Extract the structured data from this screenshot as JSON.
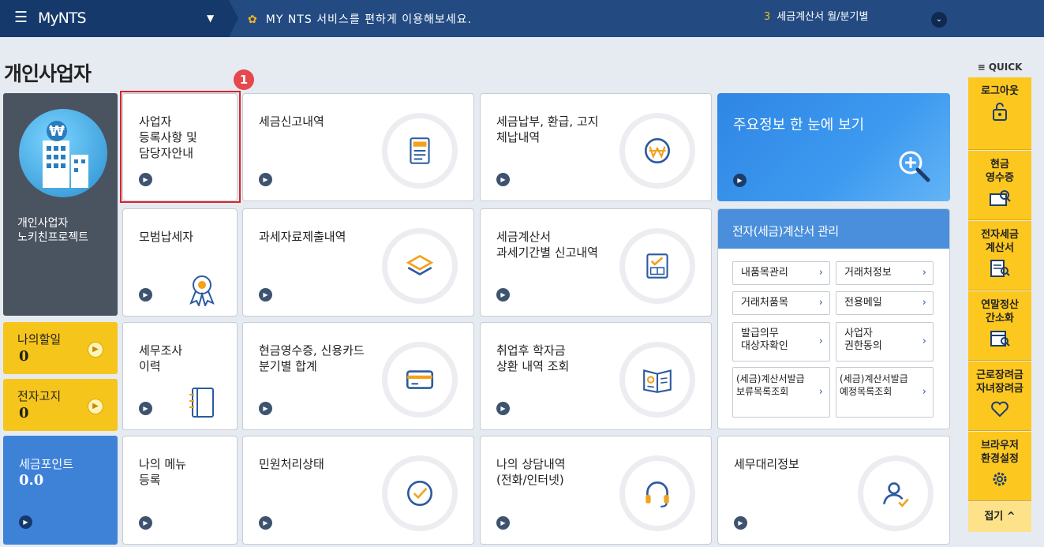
{
  "header": {
    "menu_icon": "☰",
    "app_title": "MyNTS",
    "caret": "▼",
    "notice_icon": "✿",
    "notice": "MY NTS 서비스를 편하게 이용해보세요.",
    "ticker_num": "3",
    "ticker_text": "세금계산서 월/분기별",
    "ticker_btn": "⌄"
  },
  "page_title": "개인사업자",
  "badge": "1",
  "profile": {
    "line1": "개인사업자",
    "line2": "노키친프로젝트"
  },
  "todo": {
    "label": "나의할일",
    "value": "0"
  },
  "notice_card": {
    "label": "전자고지",
    "value": "0"
  },
  "points": {
    "label": "세금포인트",
    "value": "0.0"
  },
  "tiles": {
    "t1": "사업자\n등록사항 및\n담당자안내",
    "t2": "세금신고내역",
    "t3": "세금납부, 환급, 고지\n체납내역",
    "t4": "모범납세자",
    "t5": "과세자료제출내역",
    "t6": "세금계산서\n과세기간별 신고내역",
    "t7": "세무조사\n이력",
    "t8": "현금영수증, 신용카드\n분기별 합계",
    "t9": "취업후 학자금\n상환 내역 조회",
    "t10": "나의 메뉴\n등록",
    "t11": "민원처리상태",
    "t12": "나의 상담내역\n(전화/인터넷)",
    "t13": "세무대리정보"
  },
  "summary": "주요정보 한 눈에 보기",
  "einvoice": {
    "title": "전자(세금)계산서 관리",
    "buttons": [
      "내품목관리",
      "거래처정보",
      "거래처품목",
      "전용메일",
      "발급의무\n대상자확인",
      "사업자\n권한동의",
      "(세금)계산서발급\n보류목록조회",
      "(세금)계산서발급\n예정목록조회"
    ]
  },
  "quick": {
    "title": "≡ QUICK",
    "items": [
      "로그아웃",
      "현금\n영수증",
      "전자세금\n계산서",
      "연말정산\n간소화",
      "근로장려금\n자녀장려금",
      "브라우저\n환경설정"
    ],
    "fold": "접기 ^"
  },
  "colors": {
    "accent": "#f6c51b",
    "navy": "#234b82",
    "blue": "#3e82d8",
    "selection": "#d9232e"
  }
}
